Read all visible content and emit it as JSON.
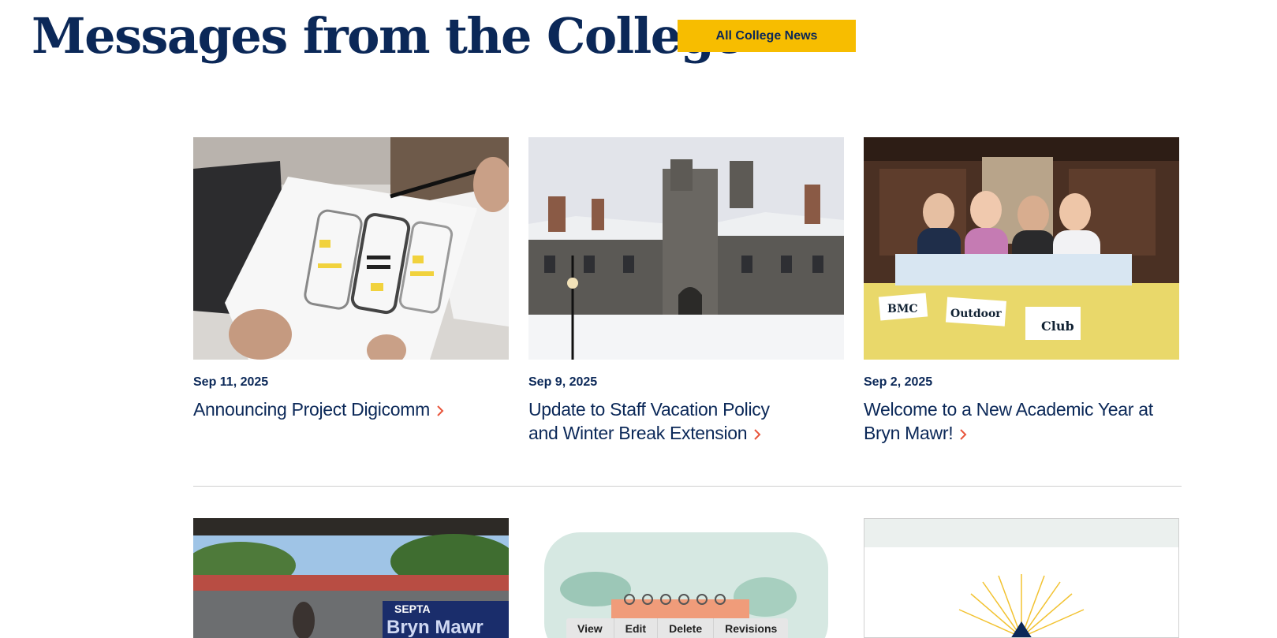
{
  "header": {
    "title": "Messages from the College",
    "all_news_label": "All College News"
  },
  "colors": {
    "navy": "#0b2858",
    "gold": "#f7bd00",
    "chevron": "#e8553b"
  },
  "articles": [
    {
      "date": "Sep 11, 2025",
      "title": "Announcing Project Digicomm",
      "image": "wireframe-sketch"
    },
    {
      "date": "Sep 9, 2025",
      "title": "Update to Staff Vacation Policy and Winter Break Extension",
      "image": "snowy-stone-hall"
    },
    {
      "date": "Sep 2, 2025",
      "title": "Welcome to a New Academic Year at Bryn Mawr!",
      "image": "students-club-table"
    }
  ],
  "second_row": {
    "station_sign": "SEPTA",
    "station_name": "Bryn Mawr"
  },
  "admin_tabs": [
    "View",
    "Edit",
    "Delete",
    "Revisions"
  ],
  "club_signs": [
    "BMC",
    "Outdoor",
    "Club"
  ]
}
